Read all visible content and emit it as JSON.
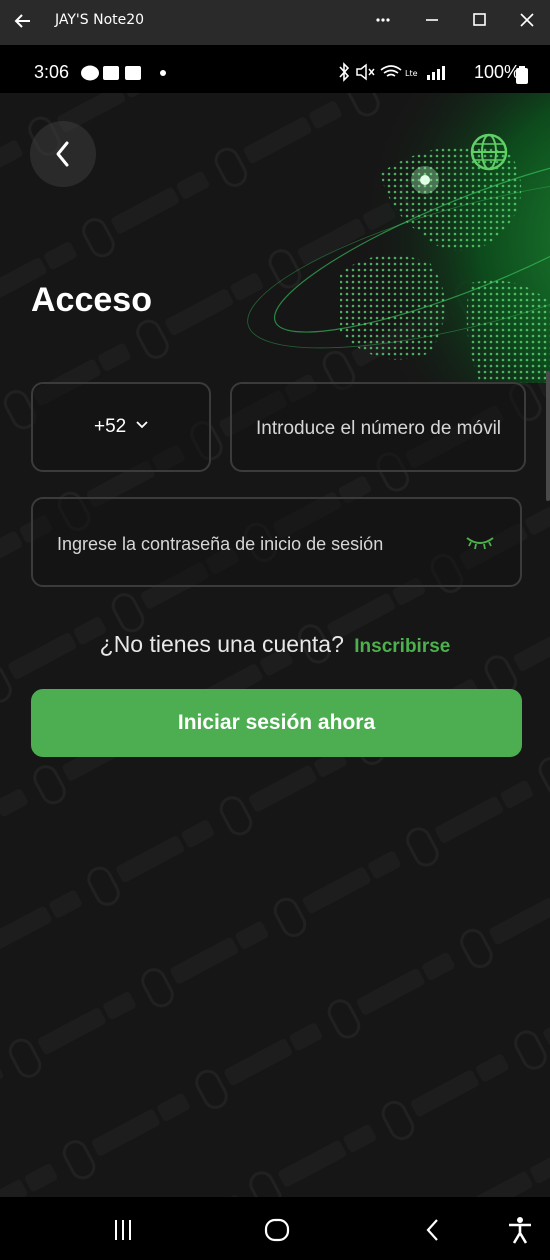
{
  "window": {
    "title": "JAY'S Note20",
    "back_icon": "arrow-left-icon",
    "buttons": [
      "more-icon",
      "minimize-icon",
      "maximize-icon",
      "close-icon"
    ]
  },
  "status_bar": {
    "time": "3:06",
    "battery": "100%",
    "left_icons": [
      "talk-icon",
      "notification-icon",
      "notification-icon",
      "dot-icon"
    ],
    "right_icons": [
      "bluetooth-icon",
      "mute-icon",
      "wifi-icon",
      "lte-icon",
      "signal-icon",
      "battery-icon"
    ]
  },
  "header": {
    "back_icon": "chevron-left-icon",
    "language_icon": "globe-icon"
  },
  "login": {
    "title": "Acceso",
    "country_code": "+52",
    "phone_placeholder": "Introduce el número de móvil",
    "password_placeholder": "Ingrese la contraseña de inicio de sesión",
    "no_account_text": "¿No tienes una cuenta?",
    "signup_link": "Inscribirse",
    "submit_label": "Iniciar sesión ahora"
  },
  "colors": {
    "accent": "#4cae50",
    "background": "#161616",
    "field_border": "#3b3b3b"
  },
  "nav_bar": {
    "items": [
      "recent-apps-icon",
      "home-icon",
      "back-icon",
      "accessibility-icon"
    ]
  }
}
